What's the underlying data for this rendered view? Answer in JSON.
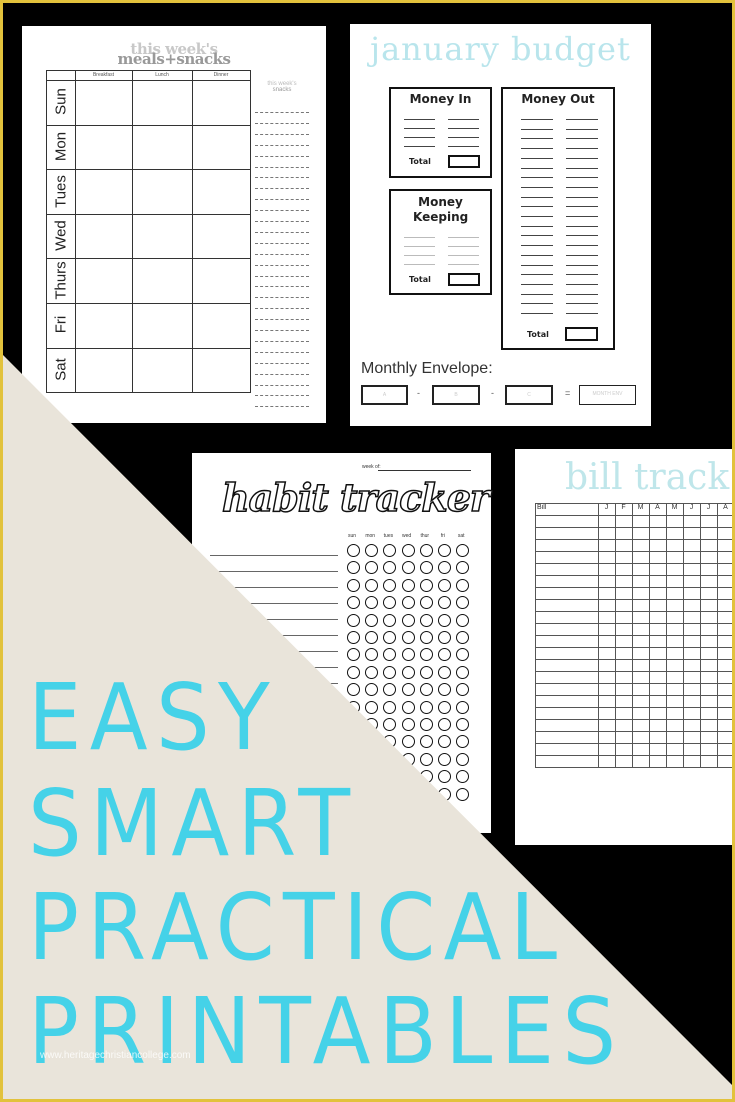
{
  "meal_planner": {
    "title_line1": "this week's",
    "title_line2": "meals+snacks",
    "columns": [
      "Breakfast",
      "Lunch",
      "Dinner"
    ],
    "days": [
      "Sun",
      "Mon",
      "Tues",
      "Wed",
      "Thurs",
      "Fri",
      "Sat"
    ],
    "snacks_line1": "this week's",
    "snacks_line2": "snacks"
  },
  "budget": {
    "title": "january budget",
    "money_in": "Money In",
    "money_out": "Money Out",
    "money_keeping": "Money Keeping",
    "total": "Total",
    "monthly_envelope": "Monthly Envelope:",
    "envelope_boxes": [
      "A",
      "B",
      "C",
      "MONTH ENV"
    ],
    "operators": [
      "-",
      "-",
      "="
    ]
  },
  "habit_tracker": {
    "week_of": "week of:",
    "title": "habit tracker",
    "days": [
      "sun",
      "mon",
      "tues",
      "wed",
      "thur",
      "fri",
      "sat"
    ]
  },
  "bill_tracker": {
    "title": "bill track",
    "header": "Bill",
    "months": [
      "J",
      "F",
      "M",
      "A",
      "M",
      "J",
      "J",
      "A"
    ]
  },
  "headline": [
    "EASY",
    "SMART",
    "PRACTICAL",
    "PRINTABLES"
  ],
  "watermark": "www.heritagechristiancollege.com",
  "colors": {
    "accent": "#45d2e8",
    "beige": "#e9e4da",
    "border": "#e2c23c",
    "background": "#000000"
  }
}
